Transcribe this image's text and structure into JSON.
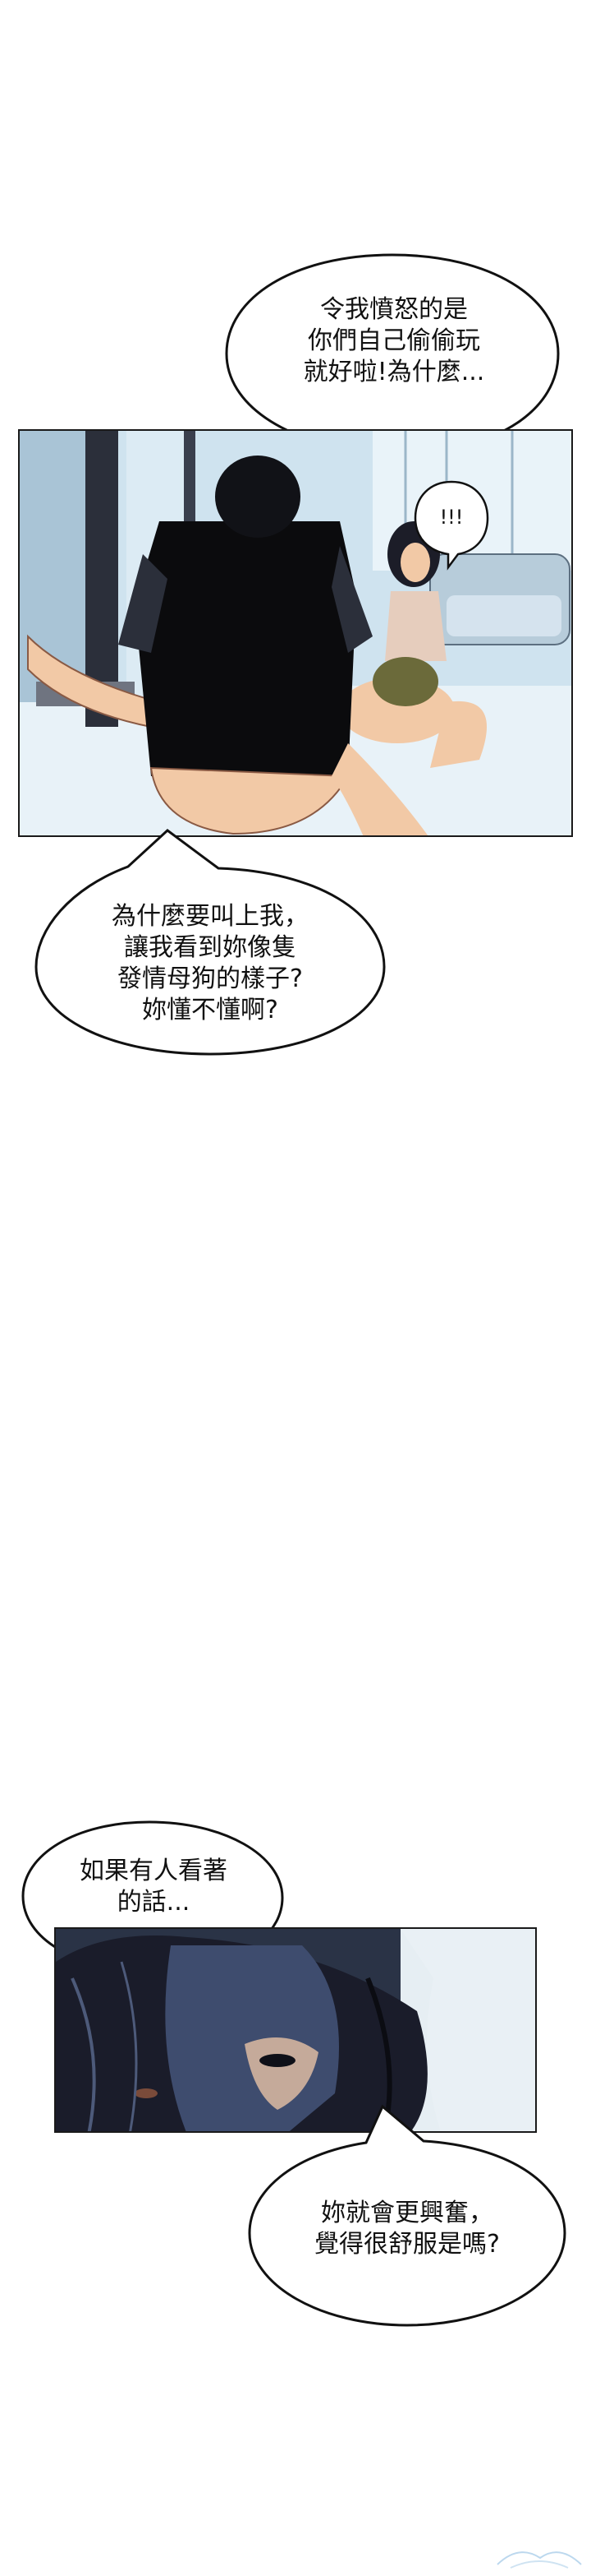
{
  "bubbles": {
    "b1": {
      "lines": [
        "令我憤怒的是",
        "你們自己偷偷玩",
        "就好啦!為什麼..."
      ]
    },
    "b2": {
      "lines": [
        "!!!"
      ]
    },
    "b3": {
      "lines": [
        "為什麼要叫上我，",
        "讓我看到妳像隻",
        "發情母狗的樣子?",
        "妳懂不懂啊?"
      ]
    },
    "b4": {
      "lines": [
        "如果有人看著",
        "的話..."
      ]
    },
    "b5": {
      "lines": [
        "妳就會更興奮，",
        "覺得很舒服是嗎?"
      ]
    }
  },
  "colors": {
    "room_wall": "#cfe3ef",
    "room_floor": "#e8f2f8",
    "shirt": "#0b0b0d",
    "skin": "#f2c9a6",
    "hair_dark": "#1a1c2a",
    "panel2_bg": "#2a3346",
    "hood": "#3e4c6e"
  }
}
